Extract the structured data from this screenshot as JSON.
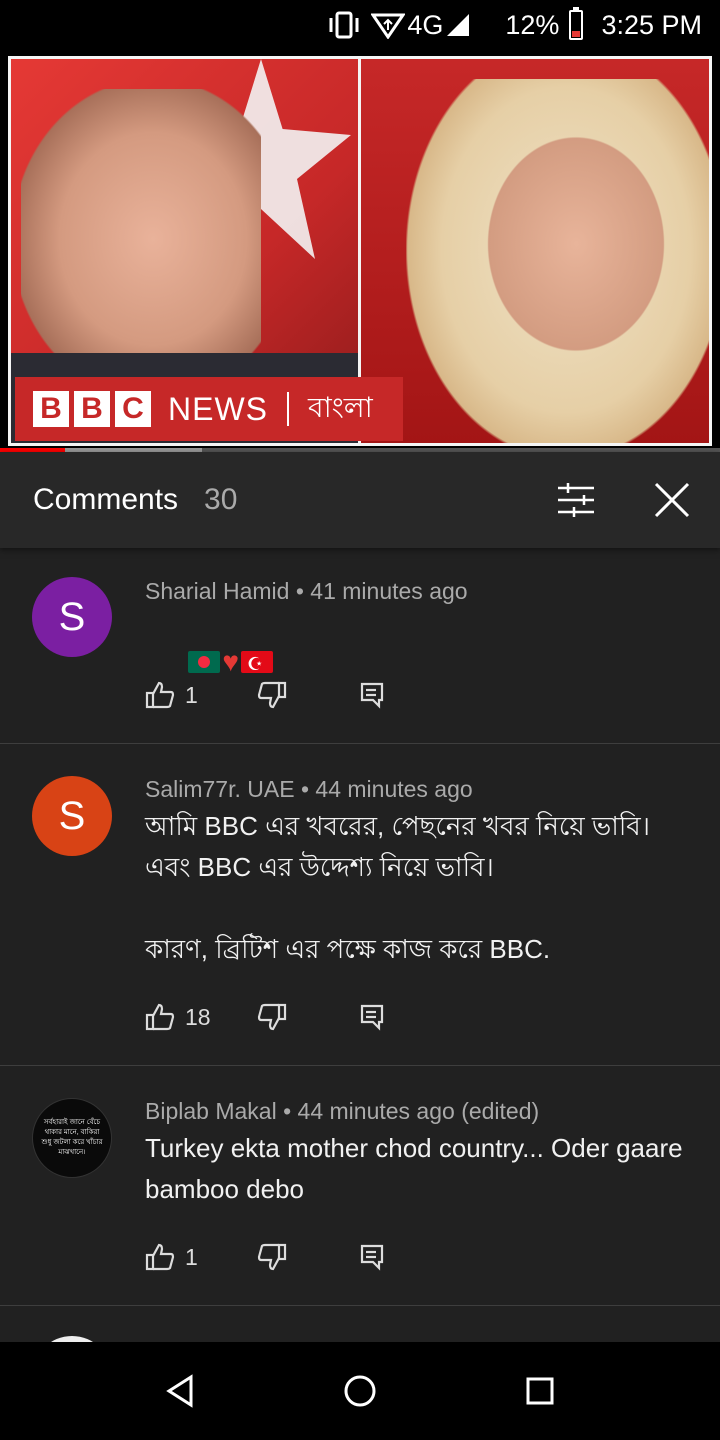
{
  "status_bar": {
    "network": "4G",
    "battery": "12%",
    "time": "3:25 PM",
    "icons": [
      "vibrate-icon",
      "data-saver-icon",
      "signal-icon",
      "battery-icon"
    ]
  },
  "video": {
    "banner_letters": [
      "B",
      "B",
      "C"
    ],
    "banner_news": "NEWS",
    "banner_lang": "বাংলা",
    "progress_played": 0.09,
    "progress_buffered": 0.28
  },
  "comments_panel": {
    "title": "Comments",
    "count": "30",
    "icons": [
      "filter-icon",
      "close-icon"
    ]
  },
  "comments": [
    {
      "avatar_letter": "S",
      "avatar_color": "#7b1fa2",
      "author": "Sharial Hamid",
      "time": "41 minutes ago",
      "text_emoji": [
        "bangladesh-flag",
        "red-heart",
        "turkey-flag"
      ],
      "likes": "1"
    },
    {
      "avatar_letter": "S",
      "avatar_color": "#d84315",
      "author": "Salim77r. UAE",
      "time": "44 minutes ago",
      "text": "আমি BBC এর খবরের, পেছনের খবর নিয়ে ভাবি।\nএবং BBC এর উদ্দেশ্য নিয়ে ভাবি।\n\nকারণ, ব্রিটিশ এর পক্ষে কাজ করে BBC.",
      "likes": "18"
    },
    {
      "avatar_text": "সর্বহারাই জানে বেঁচে থাকার মানে, বাকিরা শুধু জটলা করে খাঁচার মাঝখানে।",
      "avatar_color": "#0a0a0a",
      "author": "Biplab Makal",
      "time": "44 minutes ago (edited)",
      "text": "Turkey ekta mother chod country... Oder gaare bamboo debo",
      "likes": "1"
    }
  ],
  "meta_separator": " • ",
  "nav_bar": {
    "icons": [
      "back-icon",
      "home-icon",
      "recents-icon"
    ]
  }
}
